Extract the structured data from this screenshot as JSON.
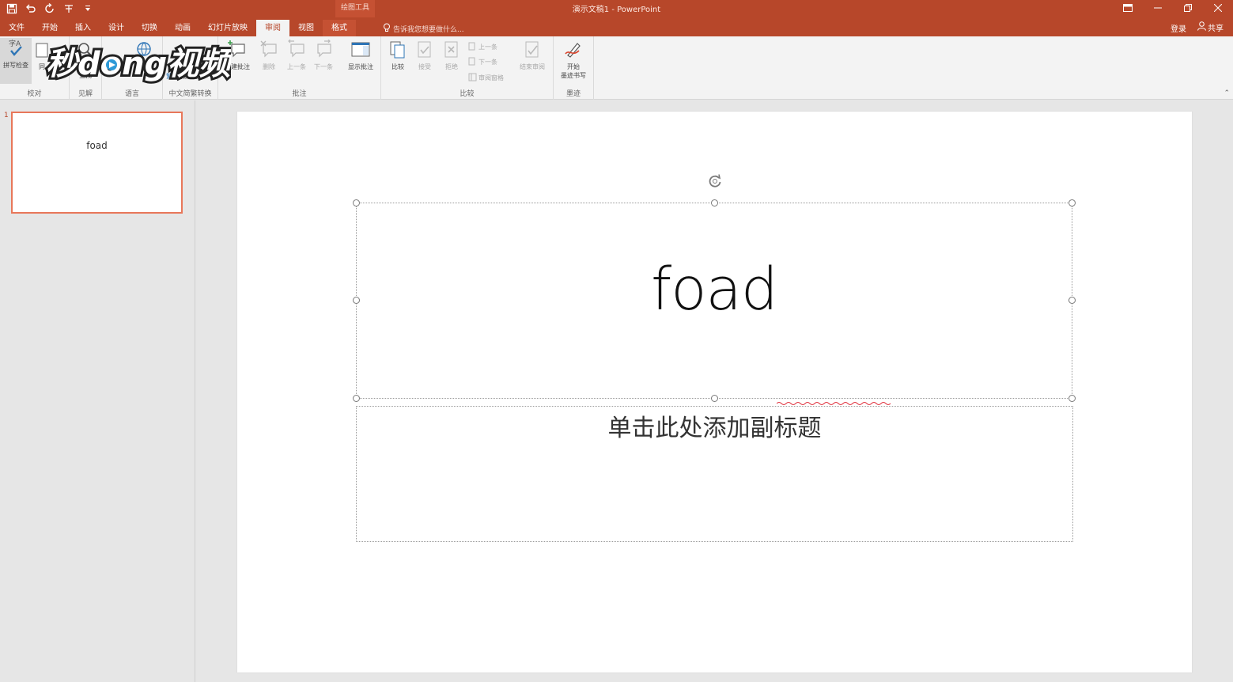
{
  "window": {
    "doc_title": "演示文稿1 - PowerPoint",
    "context_tools_label": "绘图工具",
    "quick_access": [
      "save-icon",
      "undo-icon",
      "redo-icon",
      "spell-icon",
      "customize-icon"
    ]
  },
  "tabs": [
    {
      "label": "文件"
    },
    {
      "label": "开始"
    },
    {
      "label": "插入"
    },
    {
      "label": "设计"
    },
    {
      "label": "切换"
    },
    {
      "label": "动画"
    },
    {
      "label": "幻灯片放映"
    },
    {
      "label": "审阅",
      "active": true
    },
    {
      "label": "视图"
    },
    {
      "label": "格式",
      "context": true
    }
  ],
  "tellme": {
    "placeholder": "告诉我您想要做什么..."
  },
  "account": {
    "login": "登录",
    "share": "共享"
  },
  "ribbon": {
    "groups": [
      {
        "label": "校对"
      },
      {
        "label": "见解"
      },
      {
        "label": "语言"
      },
      {
        "label": "中文简繁转换"
      },
      {
        "label": "批注"
      },
      {
        "label": "比较"
      },
      {
        "label": "墨迹"
      }
    ],
    "buttons": {
      "spell_check": "拼写检查",
      "thesaurus": "同",
      "smart_lookup": "查找",
      "new_comment": "新建批注",
      "delete": "删除",
      "previous": "上一条",
      "next": "下一条",
      "show_comments": "显示批注",
      "compare": "比较",
      "accept": "接受",
      "reject": "拒绝",
      "prev_change": "上一条",
      "next_change": "下一条",
      "reviewing_pane": "审阅窗格",
      "end_review": "结束审阅",
      "start_inking": "开始",
      "start_inking_2": "墨迹书写",
      "trad_simp_convert": "简繁转换"
    }
  },
  "watermark": {
    "text": "秒懂视频"
  },
  "thumbnails": [
    {
      "number": "1",
      "title": "foad"
    }
  ],
  "slide": {
    "title": "foad",
    "subtitle": "单击此处添加副标题"
  },
  "colors": {
    "accent": "#b7472a",
    "context_tab": "#c55133",
    "thumb_border": "#e8775a"
  }
}
